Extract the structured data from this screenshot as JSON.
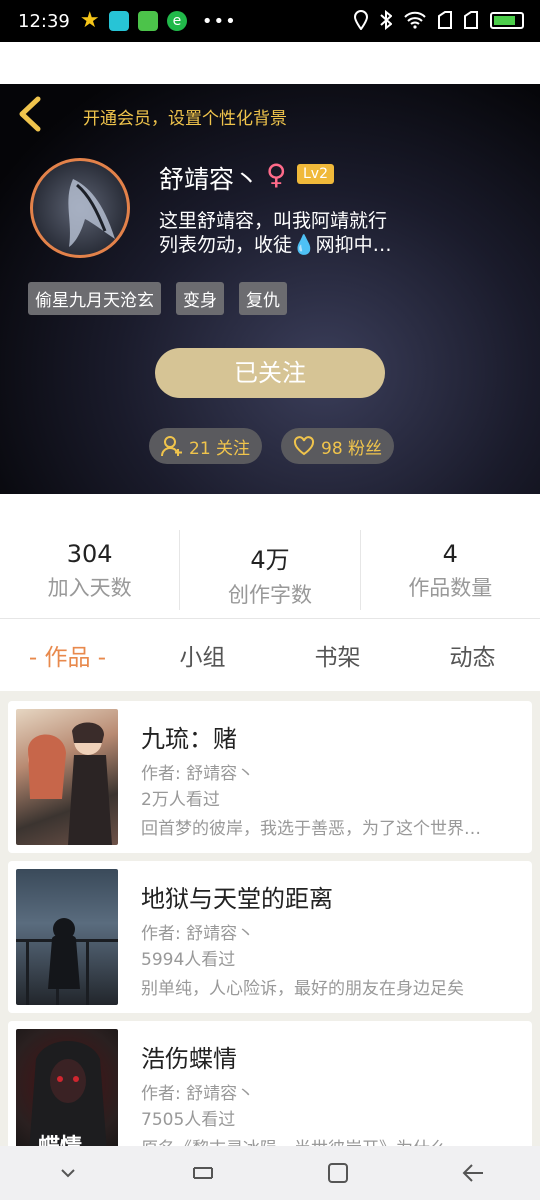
{
  "status_bar": {
    "time": "12:39",
    "dots": "•••"
  },
  "header": {
    "vip_prompt": "开通会员，设置个性化背景"
  },
  "profile": {
    "username": "舒靖容丶",
    "gender_symbol": "♀",
    "level": "Lv2",
    "bio_line1": "这里舒靖容，叫我阿靖就行",
    "bio_line2": "列表勿动，收徒💧网抑中…",
    "tags": [
      "偷星九月天沧玄",
      "变身",
      "复仇"
    ],
    "follow_button": "已关注",
    "following": "21 关注",
    "fans": "98 粉丝"
  },
  "stats": [
    {
      "value": "304",
      "label": "加入天数"
    },
    {
      "value": "4万",
      "label": "创作字数"
    },
    {
      "value": "4",
      "label": "作品数量"
    }
  ],
  "tabs": [
    {
      "label": "- 作品 -",
      "active": true
    },
    {
      "label": "小组",
      "active": false
    },
    {
      "label": "书架",
      "active": false
    },
    {
      "label": "动态",
      "active": false
    }
  ],
  "books": [
    {
      "title": "九琉：赌",
      "author": "作者: 舒靖容丶",
      "views": "2万人看过",
      "desc": "回首梦的彼岸，我选于善恶，为了这个世界…",
      "cover_text": ""
    },
    {
      "title": "地狱与天堂的距离",
      "author": "作者: 舒靖容丶",
      "views": "5994人看过",
      "desc": "别单纯，人心险诉，最好的朋友在身边足矣",
      "cover_text": ""
    },
    {
      "title": "浩伤蝶情",
      "author": "作者: 舒靖容丶",
      "views": "7505人看过",
      "desc": "原名《黎末灵冰陨，半世彼岸开》为什么…",
      "cover_text": "蝶情"
    }
  ],
  "colors": {
    "accent": "#e8894c",
    "gold": "#f0c44c",
    "follow_button": "#d6c495",
    "avatar_ring": "#e3824a"
  }
}
